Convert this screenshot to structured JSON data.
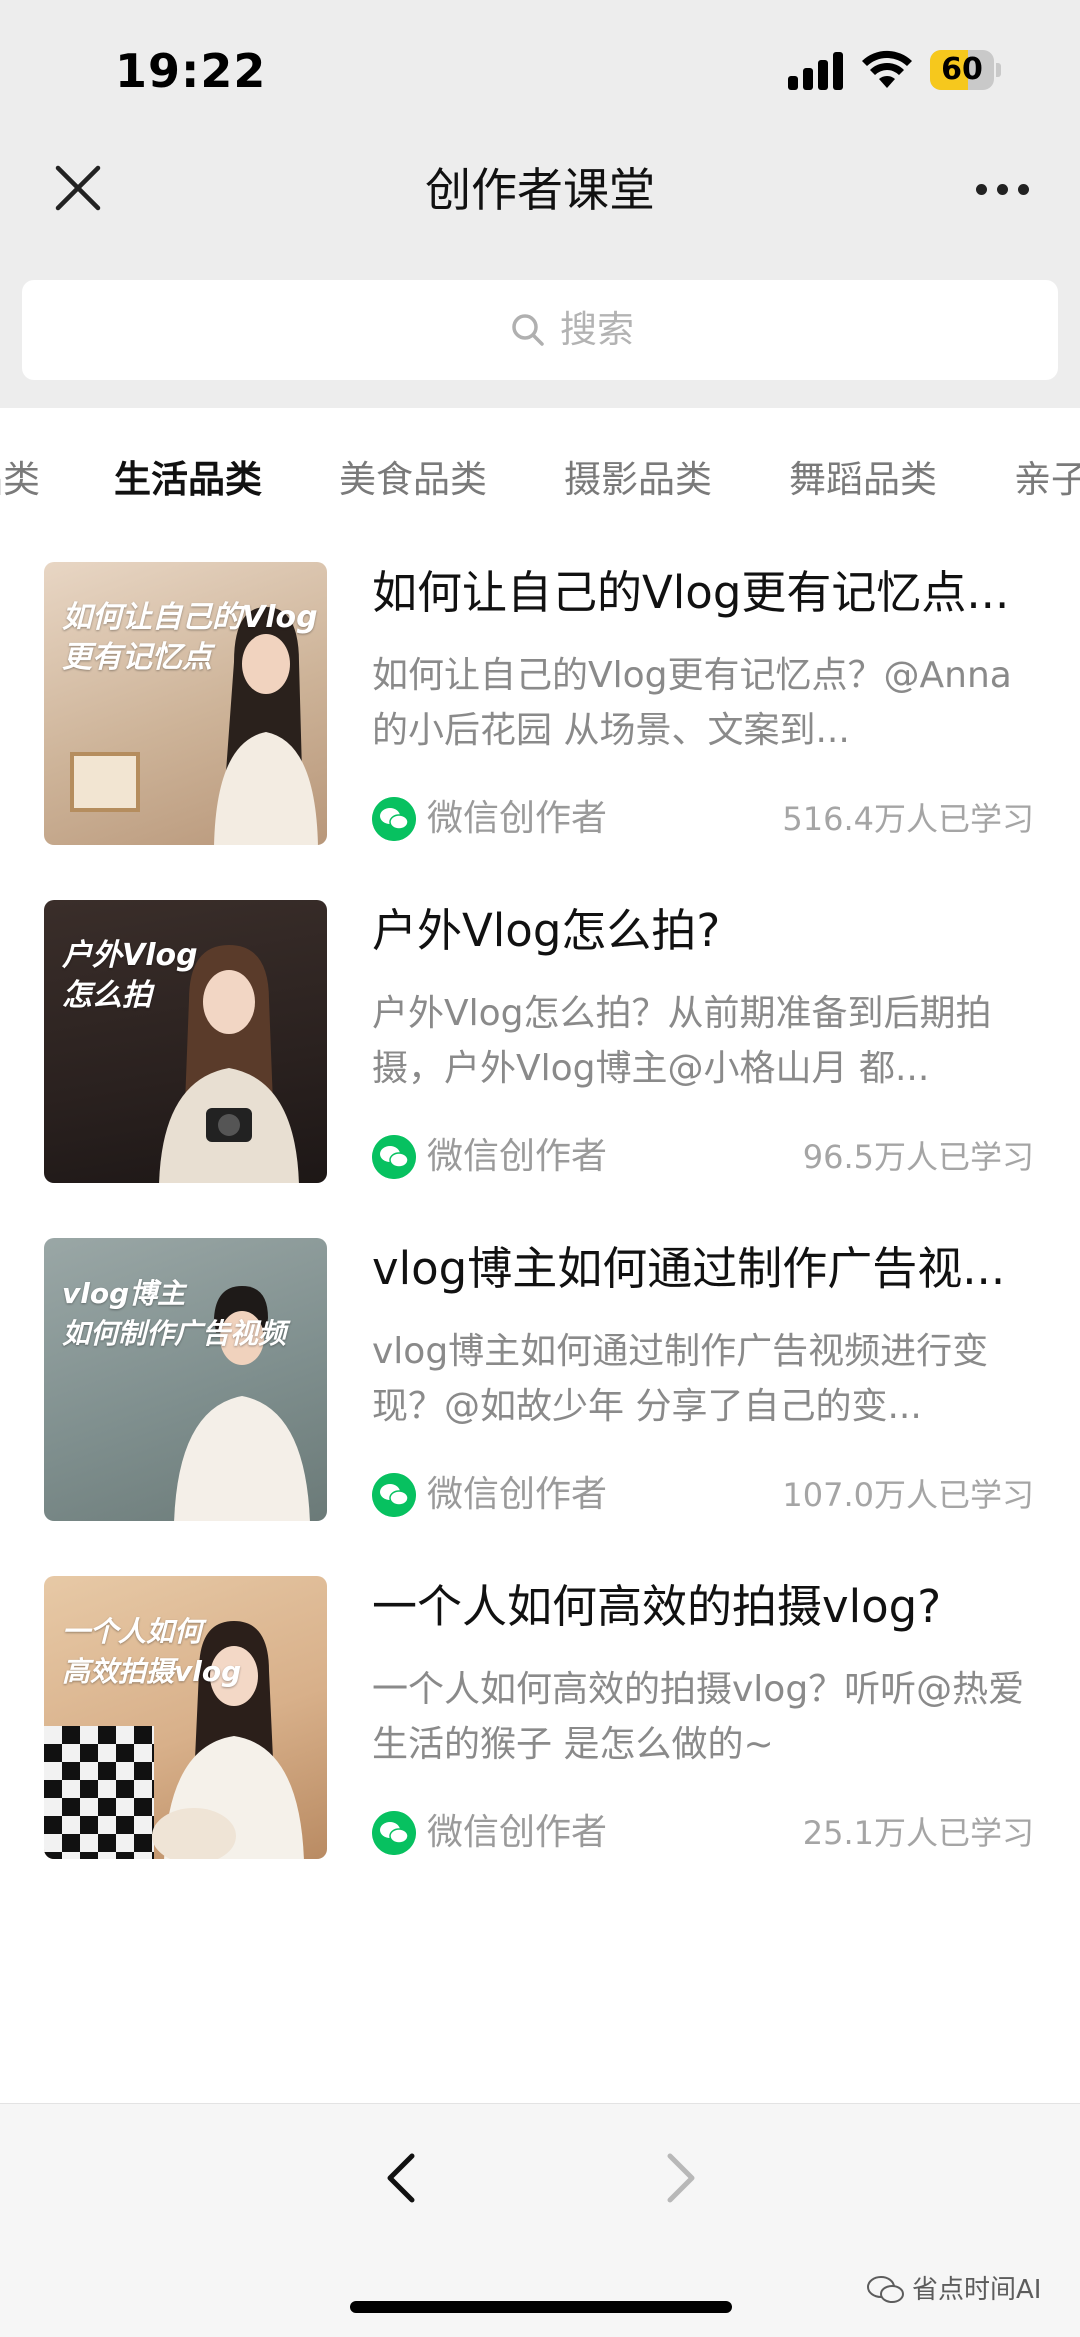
{
  "status_bar": {
    "time": "19:22",
    "battery_level": "60",
    "battery_fraction": 0.6,
    "signal_icon": "cellular-signal-icon",
    "wifi_icon": "wifi-icon"
  },
  "header": {
    "title": "创作者课堂",
    "close_icon": "close-icon",
    "more_icon": "more-dots-icon"
  },
  "search": {
    "placeholder": "搜索",
    "icon": "search-icon"
  },
  "tabs": [
    {
      "label": "品类",
      "active": false
    },
    {
      "label": "生活品类",
      "active": true
    },
    {
      "label": "美食品类",
      "active": false
    },
    {
      "label": "摄影品类",
      "active": false
    },
    {
      "label": "舞蹈品类",
      "active": false
    },
    {
      "label": "亲子",
      "active": false
    }
  ],
  "courses": [
    {
      "thumb_text": [
        "如何让自己的Vlog",
        "更有记忆点"
      ],
      "title": "如何让自己的Vlog更有记忆点...",
      "description": "如何让自己的Vlog更有记忆点？@Anna的小后花园 从场景、文案到...",
      "author": "微信创作者",
      "learners": "516.4万人已学习"
    },
    {
      "thumb_text": [
        "户外Vlog",
        "怎么拍"
      ],
      "title": "户外Vlog怎么拍?",
      "description": "户外Vlog怎么拍？从前期准备到后期拍摄，户外Vlog博主@小格山月 都...",
      "author": "微信创作者",
      "learners": "96.5万人已学习"
    },
    {
      "thumb_text": [
        "vlog博主",
        "如何制作广告视频"
      ],
      "title": "vlog博主如何通过制作广告视...",
      "description": "vlog博主如何通过制作广告视频进行变现？@如故少年 分享了自己的变...",
      "author": "微信创作者",
      "learners": "107.0万人已学习"
    },
    {
      "thumb_text": [
        "一个人如何",
        "高效拍摄vlog"
      ],
      "title": "一个人如何高效的拍摄vlog?",
      "description": "一个人如何高效的拍摄vlog？听听@热爱生活的猴子 是怎么做的~",
      "author": "微信创作者",
      "learners": "25.1万人已学习"
    }
  ],
  "toolbar": {
    "back_icon": "chevron-left-icon",
    "forward_icon": "chevron-right-icon"
  },
  "watermark": {
    "text": "省点时间AI"
  },
  "colors": {
    "wechat_green": "#07c160",
    "battery_yellow": "#f6c81d",
    "header_bg": "#ededed"
  }
}
